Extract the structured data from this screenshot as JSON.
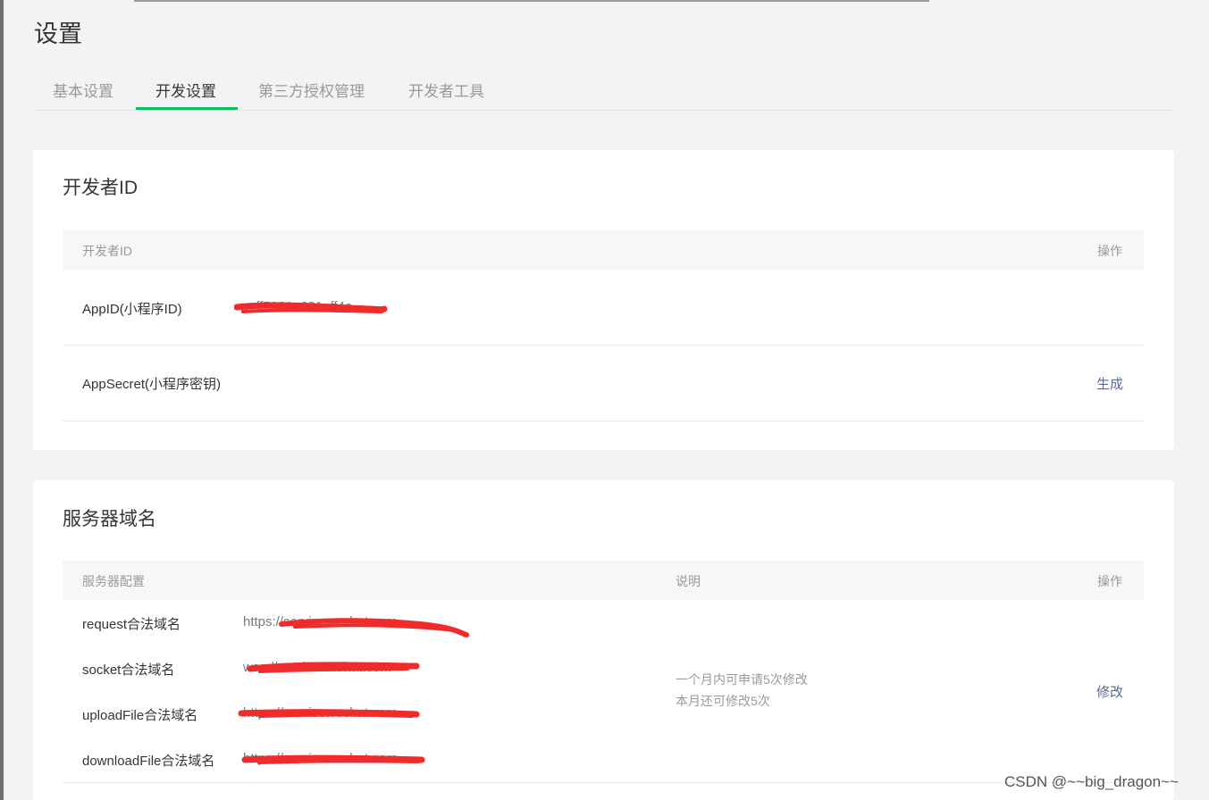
{
  "page": {
    "title": "设置"
  },
  "tabs": [
    {
      "label": "基本设置",
      "active": false
    },
    {
      "label": "开发设置",
      "active": true
    },
    {
      "label": "第三方授权管理",
      "active": false
    },
    {
      "label": "开发者工具",
      "active": false
    }
  ],
  "developer_id_card": {
    "title": "开发者ID",
    "header": {
      "col1": "开发者ID",
      "col_action": "操作"
    },
    "rows": [
      {
        "label": "AppID(小程序ID)",
        "value_fragment": "wxff7331e681eff4a",
        "redacted": true
      },
      {
        "label": "AppSecret(小程序密钥)",
        "action": "生成"
      }
    ]
  },
  "server_domain_card": {
    "title": "服务器域名",
    "header": {
      "col1": "服务器配置",
      "col2": "说明",
      "col_action": "操作"
    },
    "domains": [
      {
        "label": "request合法域名",
        "value_fragment": "https://servicewechat.com",
        "redacted": true
      },
      {
        "label": "socket合法域名",
        "value_fragment": "wss://servicewechat.com",
        "redacted": true
      },
      {
        "label": "uploadFile合法域名",
        "value_fragment": "https://servicewechat.com",
        "redacted": true
      },
      {
        "label": "downloadFile合法域名",
        "value_fragment": "https://servicewechat.com",
        "redacted": true
      }
    ],
    "note_lines": [
      "一个月内可申请5次修改",
      "本月还可修改5次"
    ],
    "action": "修改"
  },
  "watermark": "CSDN @~~big_dragon~~",
  "colors": {
    "accent_green": "#07c160",
    "link_blue": "#576b95",
    "redaction_red": "#ef2b2b"
  }
}
